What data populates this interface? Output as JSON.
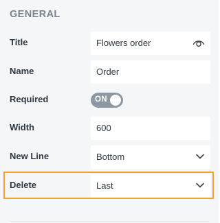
{
  "panel": {
    "section_title": "GENERAL"
  },
  "fields": {
    "title": {
      "label": "Title",
      "value": "Flowers order",
      "icon": "eye-icon"
    },
    "name": {
      "label": "Name",
      "value": "Order"
    },
    "required": {
      "label": "Required",
      "toggle_text": "ON",
      "state": "on"
    },
    "width": {
      "label": "Width",
      "value": "600"
    },
    "new_line": {
      "label": "New Line",
      "value": "Bottom"
    },
    "delete": {
      "label": "Delete",
      "value": "Last"
    }
  },
  "colors": {
    "highlight": "#f0a32a",
    "toggle_bg": "#8d98a3",
    "panel_bg": "#f5f6f8"
  }
}
